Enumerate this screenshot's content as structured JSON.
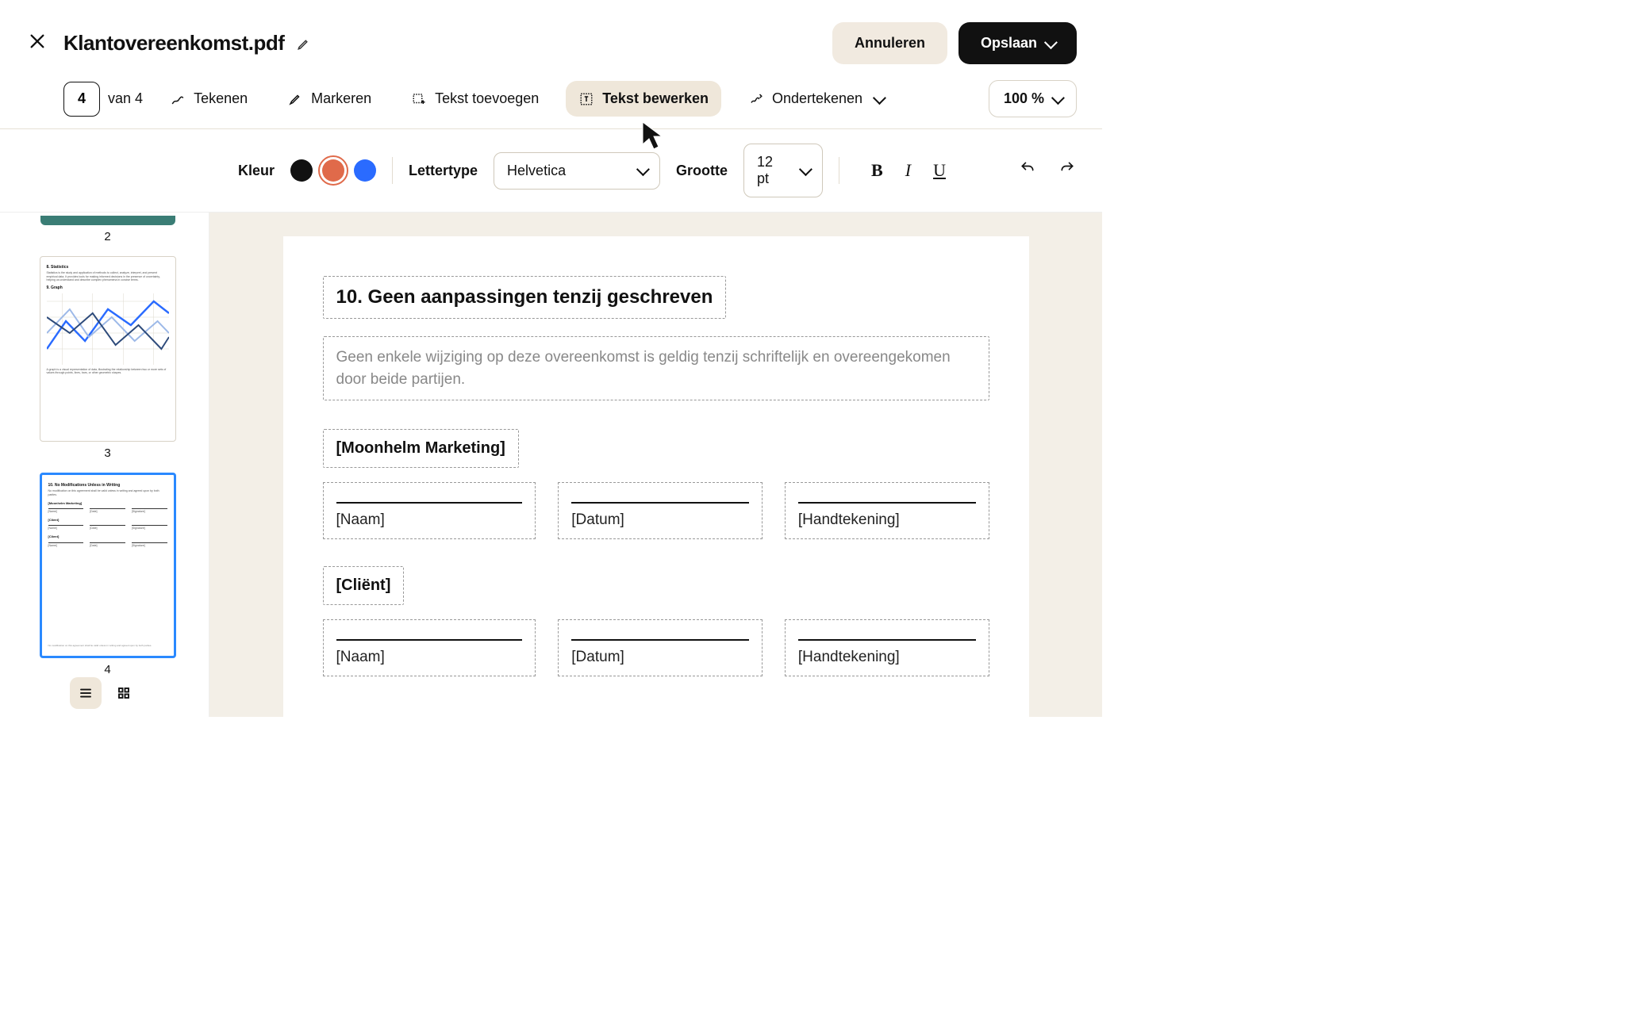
{
  "header": {
    "title": "Klantovereenkomst.pdf",
    "cancel": "Annuleren",
    "save": "Opslaan"
  },
  "toolbar": {
    "page_current": "4",
    "page_sep": "van",
    "page_total": "4",
    "draw": "Tekenen",
    "highlight": "Markeren",
    "add_text": "Tekst toevoegen",
    "edit_text": "Tekst bewerken",
    "sign": "Ondertekenen",
    "zoom": "100 %"
  },
  "subbar": {
    "color_label": "Kleur",
    "colors": [
      "#111111",
      "#e06a4a",
      "#2a6bff"
    ],
    "selected_color_index": 1,
    "font_label": "Lettertype",
    "font_value": "Helvetica",
    "size_label": "Grootte",
    "size_value": "12 pt"
  },
  "thumbs": {
    "p2": "2",
    "p3": "3",
    "p4": "4",
    "t3_h1": "8. Statistics",
    "t3_p1": "Statistics is the study and application of methods to collect, analyze, interpret, and present empirical data. It provides tools for making informed decisions in the presence of uncertainty, helping us understand and describe complex phenomena in concise terms.",
    "t3_h2": "9. Graph",
    "t3_p2": "A graph is a visual representation of data, illustrating the relationship between two or more sets of values through points, lines, bars, or other geometric shapes.",
    "t4_h1": "10. No Modifications Unless in Writing",
    "t4_p1": "No modification on this agreement shall be valid unless in writing and agreed upon by both parties.",
    "t4_party1": "[Moonhelm Marketing]",
    "t4_party2": "[Client]",
    "t4_name": "[Name]",
    "t4_date": "[Date]",
    "t4_sig": "[Signature]"
  },
  "doc": {
    "section_title": "10. Geen aanpassingen tenzij geschreven",
    "section_body": "Geen enkele wijziging op deze overeenkomst is geldig tenzij schriftelijk en overeengekomen door beide partijen.",
    "party1": "[Moonhelm Marketing]",
    "party2": "[Cliënt]",
    "name": "[Naam]",
    "date": "[Datum]",
    "signature": "[Handtekening]"
  }
}
